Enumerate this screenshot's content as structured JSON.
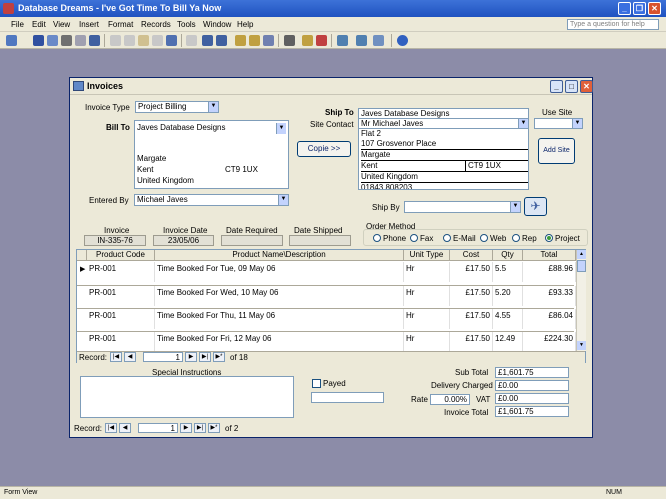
{
  "app": {
    "title": "Database Dreams - I've Got Time To Bill Ya Now",
    "menu": [
      "File",
      "Edit",
      "View",
      "Insert",
      "Format",
      "Records",
      "Tools",
      "Window",
      "Help"
    ],
    "ask_placeholder": "Type a question for help",
    "status_left": "Form View",
    "status_right": "NUM"
  },
  "form": {
    "title": "Invoices",
    "invoice_type_label": "Invoice Type",
    "invoice_type_value": "Project Billing",
    "bill_to_label": "Bill To",
    "bill_to": {
      "company": "Javes Database Designs",
      "city": "Margate",
      "county": "Kent",
      "postcode": "CT9 1UX",
      "country": "United Kingdom"
    },
    "entered_by_label": "Entered By",
    "entered_by_value": "Michael Javes",
    "ship_to_label": "Ship To",
    "ship_to_company": "Javes Database Designs",
    "site_contact_label": "Site Contact",
    "site_contact": "Mr Michael Javes",
    "ship_lines": [
      "Flat 2",
      "107 Grosvenor Place",
      "Margate"
    ],
    "ship_county": "Kent",
    "ship_postcode": "CT9 1UX",
    "ship_country": "United Kingdom",
    "ship_phone": "01843 808203",
    "copie_button": "Copie >>",
    "use_site_label": "Use Site",
    "add_site_button": "Add Site",
    "ship_by_label": "Ship By",
    "ship_by_value": "",
    "invoice_label": "Invoice",
    "invoice_value": "IN-335-76",
    "invoice_date_label": "Invoice Date",
    "invoice_date_value": "23/05/06",
    "date_required_label": "Date Required",
    "date_required_value": "",
    "date_shipped_label": "Date Shipped",
    "date_shipped_value": "",
    "order_method_label": "Order Method",
    "order_methods": [
      "Phone",
      "Fax",
      "E-Mail",
      "Web",
      "Rep",
      "Project"
    ],
    "order_method_selected": "Project",
    "lines": {
      "columns": [
        "Product Code",
        "Product Name\\Description",
        "Unit Type",
        "Cost",
        "Qty",
        "Total"
      ],
      "rows": [
        {
          "code": "PR-001",
          "desc": "Time Booked For Tue, 09 May 06",
          "unit": "Hr",
          "cost": "£17.50",
          "qty": "5.5",
          "total": "£88.96"
        },
        {
          "code": "PR-001",
          "desc": "Time Booked For Wed, 10 May 06",
          "unit": "Hr",
          "cost": "£17.50",
          "qty": "5.20",
          "total": "£93.33"
        },
        {
          "code": "PR-001",
          "desc": "Time Booked For Thu, 11 May 06",
          "unit": "Hr",
          "cost": "£17.50",
          "qty": "4.55",
          "total": "£86.04"
        },
        {
          "code": "PR-001",
          "desc": "Time Booked For Fri, 12 May 06",
          "unit": "Hr",
          "cost": "£17.50",
          "qty": "12.49",
          "total": "£224.30"
        }
      ],
      "record_label": "Record:",
      "record_current": "1",
      "record_of": "of 18"
    },
    "special_instructions_label": "Special Instructions",
    "special_instructions": "",
    "payed_label": "Payed",
    "sub_total_label": "Sub Total",
    "sub_total": "£1,601.75",
    "delivery_label": "Delivery Charged",
    "delivery": "£0.00",
    "rate_label": "Rate",
    "rate": "0.00%",
    "vat_label": "VAT",
    "vat": "£0.00",
    "invoice_total_label": "Invoice Total",
    "invoice_total": "£1,601.75",
    "record_label": "Record:",
    "record_current": "1",
    "record_of": "of 2"
  }
}
